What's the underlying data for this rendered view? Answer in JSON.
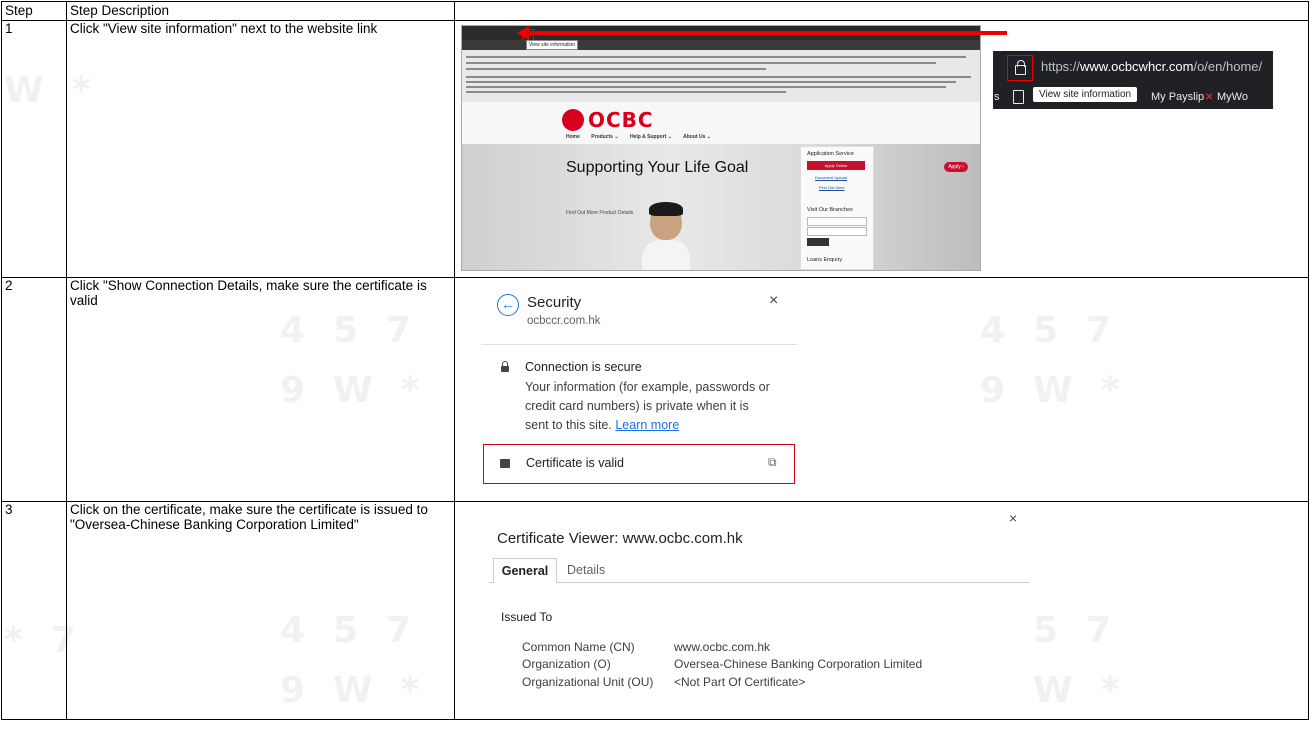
{
  "table": {
    "headers": {
      "step": "Step",
      "description": "Step Description"
    },
    "rows": [
      {
        "step": "1",
        "description": "Click \"View site information\" next to the website link"
      },
      {
        "step": "2",
        "description": "Click \"Show Connection Details, make sure the certificate is valid"
      },
      {
        "step": "3",
        "description": "Click on the certificate, make sure the certificate is issued to \"Oversea-Chinese Banking Corporation Limited\""
      }
    ]
  },
  "step1_screenshot": {
    "browser_tooltip": "View site information",
    "bank_logo": "OCBC",
    "nav": [
      "Home",
      "Products ⌄",
      "Help & Support ⌄",
      "About Us ⌄"
    ],
    "hero_title": "Supporting Your Life Goal",
    "hero_link": "Find Out More Product Details",
    "panel": {
      "heading": "Application Service",
      "apply_button": "Apply Online",
      "link1": "Document Upload",
      "link2": "Find Out More",
      "branches": "Visit Our Branches",
      "loans": "Loans Enquiry"
    },
    "apply_pill": "Apply ›",
    "zoom": {
      "url_prefix": "https://",
      "url_domain": "www.ocbcwhcr.com",
      "url_path": "/o/en/home/",
      "tooltip": "View site information",
      "left_fragment": "s",
      "bookmark1": "My Payslip",
      "bookmark2": "MyWo"
    }
  },
  "step2_popup": {
    "title": "Security",
    "domain": "ocbccr.com.hk",
    "close": "×",
    "heading": "Connection is secure",
    "body": "Your information (for example, passwords or credit card numbers) is private when it is sent to this site.",
    "link": "Learn more",
    "certificate": "Certificate is valid"
  },
  "step3_viewer": {
    "title": "Certificate Viewer: www.ocbc.com.hk",
    "close": "×",
    "tabs": [
      "General",
      "Details"
    ],
    "section": "Issued To",
    "fields": [
      {
        "key": "Common Name (CN)",
        "value": "www.ocbc.com.hk"
      },
      {
        "key": "Organization (O)",
        "value": "Oversea-Chinese Banking Corporation Limited"
      },
      {
        "key": "Organizational Unit (OU)",
        "value": "<Not Part Of Certificate>"
      }
    ]
  },
  "colors": {
    "accent_red": "#d6001c",
    "highlight_box": "#e00000",
    "link_blue": "#1a73e8"
  }
}
